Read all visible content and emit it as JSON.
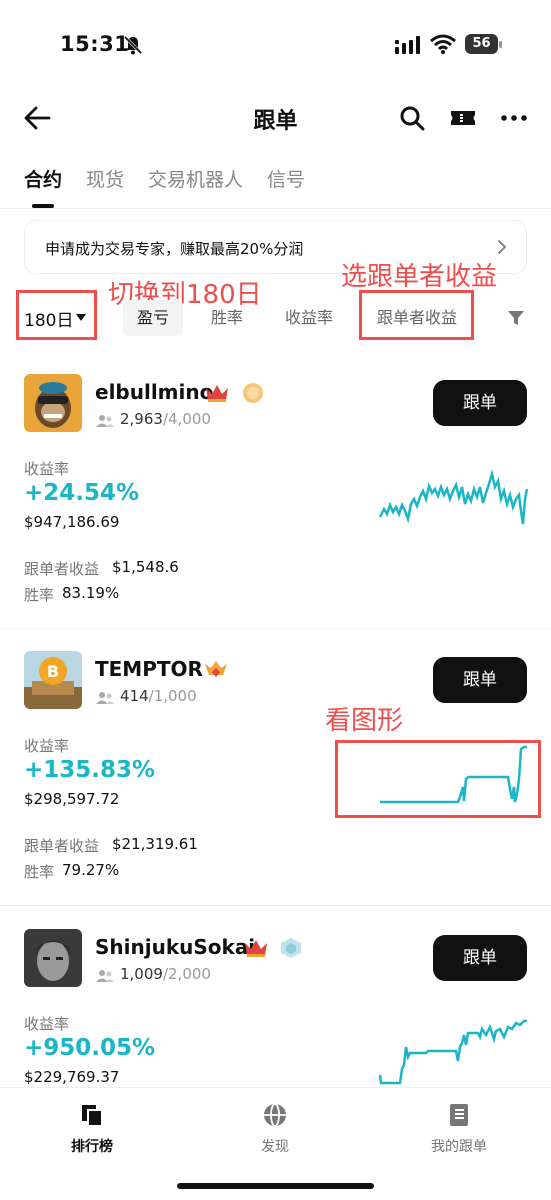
{
  "status": {
    "time": "15:31",
    "battery": "56"
  },
  "nav": {
    "title": "跟单"
  },
  "tabs": [
    {
      "label": "合约"
    },
    {
      "label": "现货"
    },
    {
      "label": "交易机器人"
    },
    {
      "label": "信号"
    }
  ],
  "banner": {
    "text": "申请成为交易专家，赚取最高20%分润"
  },
  "filters": {
    "period": "180日",
    "chips": [
      {
        "label": "盈亏"
      },
      {
        "label": "胜率"
      },
      {
        "label": "收益率"
      },
      {
        "label": "跟单者收益"
      }
    ]
  },
  "annotations": {
    "switch_period": "切换到180日",
    "select_follower_pnl": "选跟单者收益",
    "view_chart": "看图形"
  },
  "traders": [
    {
      "name": "elbullmino",
      "followers_current": "2,963",
      "followers_max": "/4,000",
      "follow_label": "跟单",
      "roi_label": "收益率",
      "roi": "+24.54%",
      "pnl": "$947,186.69",
      "follower_pnl_label": "跟单者收益",
      "follower_pnl": "$1,548.6",
      "winrate_label": "胜率",
      "winrate": "83.19%"
    },
    {
      "name": "TEMPTOR",
      "followers_current": "414",
      "followers_max": "/1,000",
      "follow_label": "跟单",
      "roi_label": "收益率",
      "roi": "+135.83%",
      "pnl": "$298,597.72",
      "follower_pnl_label": "跟单者收益",
      "follower_pnl": "$21,319.61",
      "winrate_label": "胜率",
      "winrate": "79.27%"
    },
    {
      "name": "ShinjukuSokai",
      "followers_current": "1,009",
      "followers_max": "/2,000",
      "follow_label": "跟单",
      "roi_label": "收益率",
      "roi": "+950.05%",
      "pnl": "$229,769.37"
    }
  ],
  "bottom_nav": [
    {
      "label": "排行榜"
    },
    {
      "label": "发现"
    },
    {
      "label": "我的跟单"
    }
  ],
  "colors": {
    "accent": "#1bb6c6",
    "annotation": "#ef4e4e",
    "button": "#111111"
  }
}
